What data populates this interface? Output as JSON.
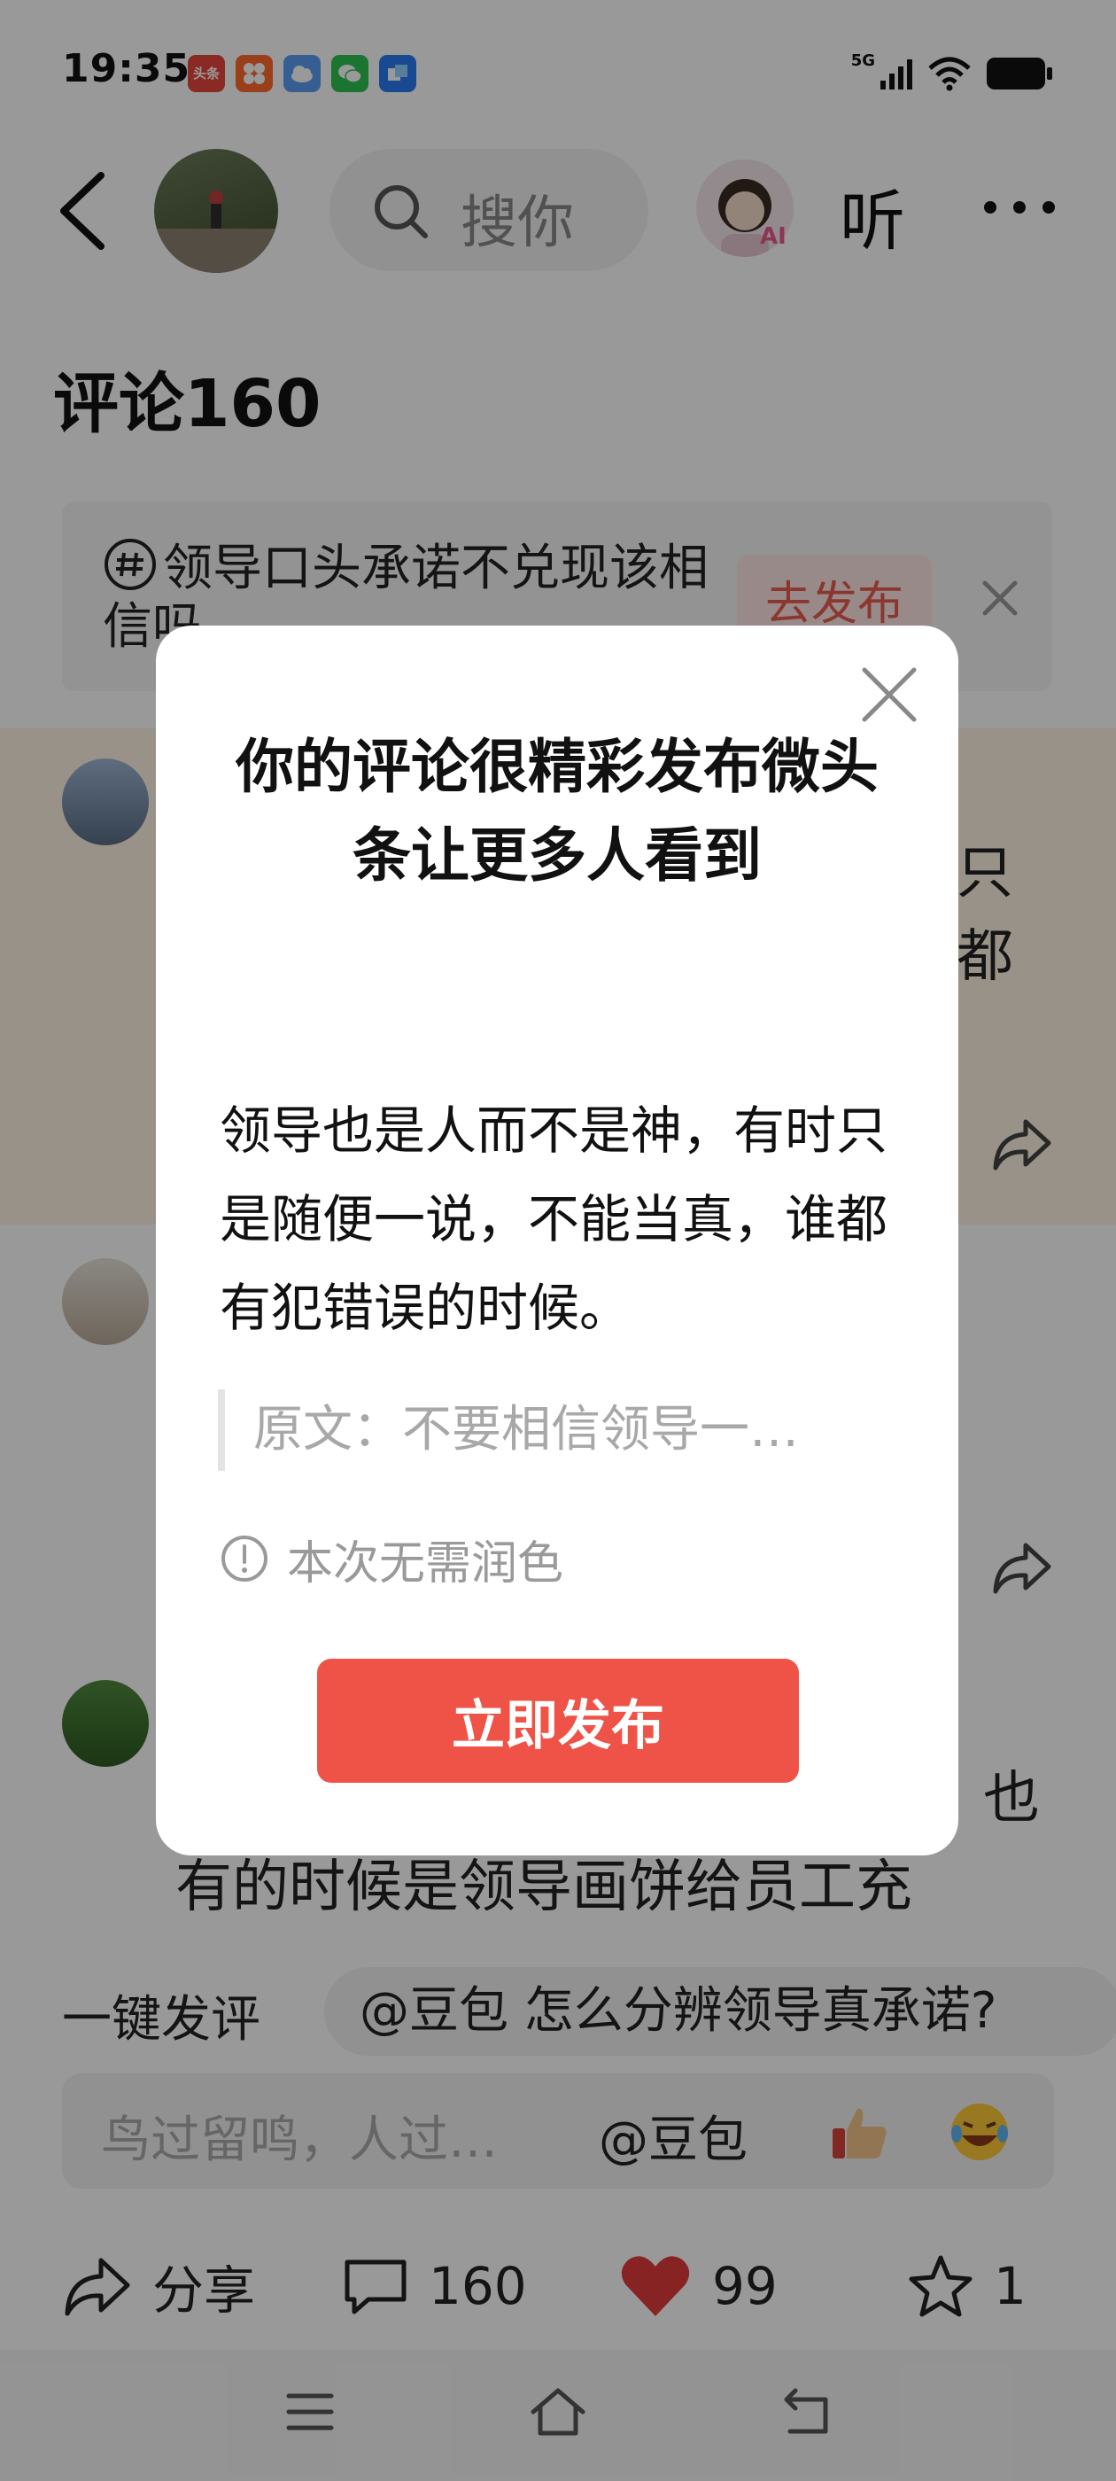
{
  "status_bar": {
    "time": "19:35",
    "apps": [
      {
        "name": "toutiao-icon",
        "label": "头条",
        "color": "#e8453c"
      },
      {
        "name": "app-orange-icon",
        "label": "",
        "color": "#ff6a2b"
      },
      {
        "name": "cloud-icon",
        "label": "",
        "color": "#5b9df5"
      },
      {
        "name": "wechat-icon",
        "label": "",
        "color": "#2ec250"
      },
      {
        "name": "app-blue-icon",
        "label": "",
        "color": "#2b7cf2"
      }
    ],
    "network": "5G"
  },
  "header": {
    "search_placeholder": "搜你",
    "ai_badge": "AI",
    "listen_label": "听"
  },
  "comments": {
    "title": "评论160"
  },
  "topic_banner": {
    "text": "领导口头承诺不兑现该相信吗",
    "button": "去发布"
  },
  "background_fragments": {
    "line1_tail": "只",
    "line2_tail": "都",
    "third_comment_tail": "也",
    "third_comment_line": "有的时候是领导画饼给员工充"
  },
  "ai_suggest": {
    "label": "一键发评",
    "chip": "@豆包 怎么分辨领导真承诺?"
  },
  "input_bar": {
    "placeholder": "鸟过留鸣，人过…",
    "mention": "@豆包"
  },
  "actions": {
    "share": "分享",
    "comments_count": "160",
    "likes_count": "99",
    "favorites_count": "1"
  },
  "modal": {
    "title": "你的评论很精彩发布微头条让更多人看到",
    "body": "领导也是人而不是神，有时只是随便一说，不能当真，谁都有犯错误的时候。",
    "quote": "原文：不要相信领导一…",
    "notice": "本次无需润色",
    "button": "立即发布"
  },
  "colors": {
    "accent": "#ef5347",
    "like": "#e13b3b"
  }
}
